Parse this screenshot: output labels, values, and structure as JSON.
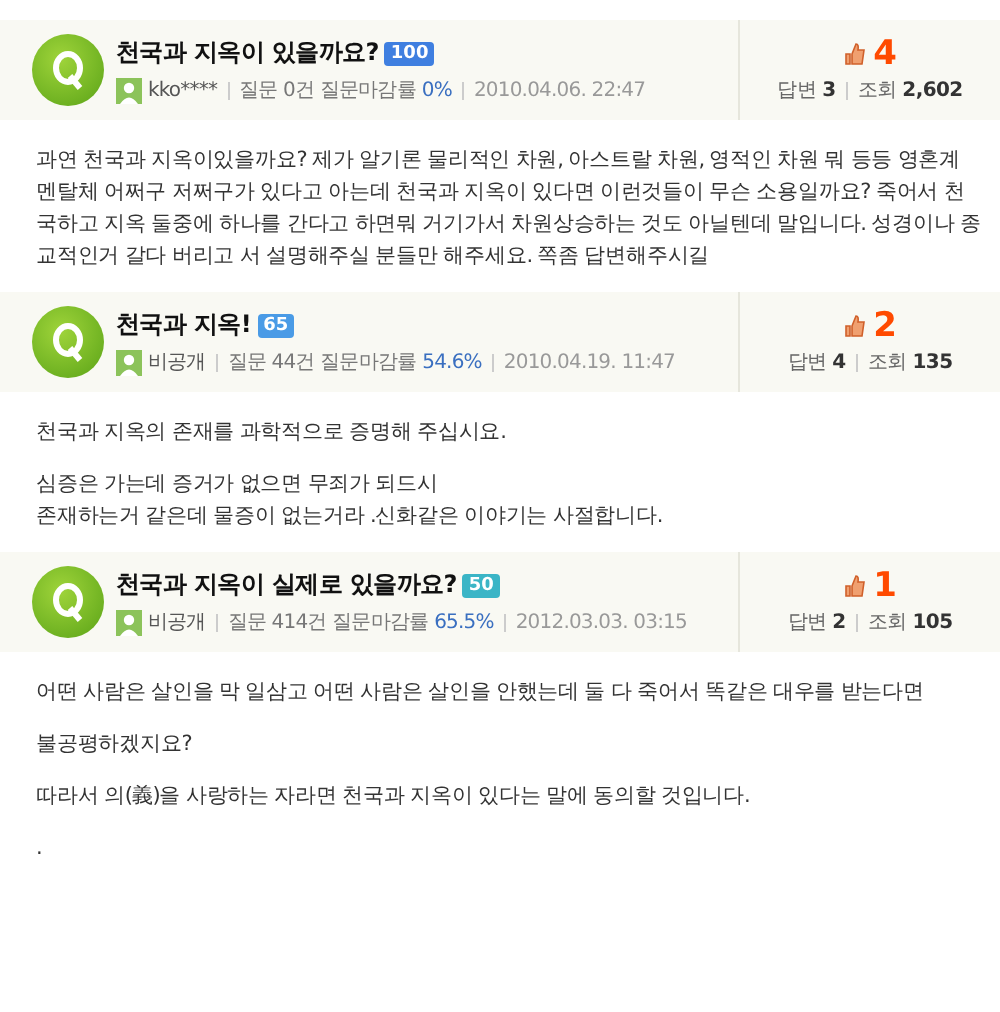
{
  "posts": [
    {
      "title": "천국과 지옥이 있을까요?",
      "points": "100",
      "color": "#3f7fe0",
      "user": "kko****",
      "question_count": "질문 0건 질문마감률",
      "close_rate": "0%",
      "date": "2010.04.06. 22:47",
      "likes": "4",
      "answers_label": "답변",
      "answers": "3",
      "views_label": "조회",
      "views": "2,602",
      "paragraphs": [
        "과연 천국과 지옥이있을까요? 제가 알기론 물리적인 차원, 아스트랄 차원, 영적인 차원 뭐 등등 영혼계 멘탈체 어쩌구 저쩌구가 있다고 아는데 천국과 지옥이 있다면 이런것들이 무슨 소용일까요? 죽어서 천국하고 지옥 둘중에 하나를 간다고 하면뭐 거기가서 차원상승하는 것도 아닐텐데 말입니다. 성경이나 종교적인거 갈다 버리고 서 설명해주실 분들만 해주세요.  쪽좀 답변해주시길"
      ]
    },
    {
      "title": "천국과 지옥!",
      "points": "65",
      "color": "#4a9be6",
      "user": "비공개",
      "question_count": "질문 44건 질문마감률",
      "close_rate": "54.6%",
      "date": "2010.04.19. 11:47",
      "likes": "2",
      "answers_label": "답변",
      "answers": "4",
      "views_label": "조회",
      "views": "135",
      "paragraphs": [
        "천국과 지옥의 존재를 과학적으로 증명해 주십시요.",
        "심증은 가는데 증거가 없으면 무죄가 되드시\n존재하는거 같은데 물증이 없는거라 .신화같은 이야기는 사절합니다."
      ]
    },
    {
      "title": "천국과 지옥이 실제로 있을까요?",
      "points": "50",
      "color": "#3bb5c6",
      "user": "비공개",
      "question_count": "질문 414건 질문마감률",
      "close_rate": "65.5%",
      "date": "2012.03.03. 03:15",
      "likes": "1",
      "answers_label": "답변",
      "answers": "2",
      "views_label": "조회",
      "views": "105",
      "paragraphs": [
        "어떤 사람은 살인을 막 일삼고 어떤 사람은 살인을 안했는데 둘 다 죽어서 똑같은 대우를 받는다면",
        "불공평하겠지요?",
        "따라서 의(義)을 사랑하는 자라면 천국과 지옥이 있다는 말에 동의할 것입니다.",
        "."
      ]
    }
  ]
}
